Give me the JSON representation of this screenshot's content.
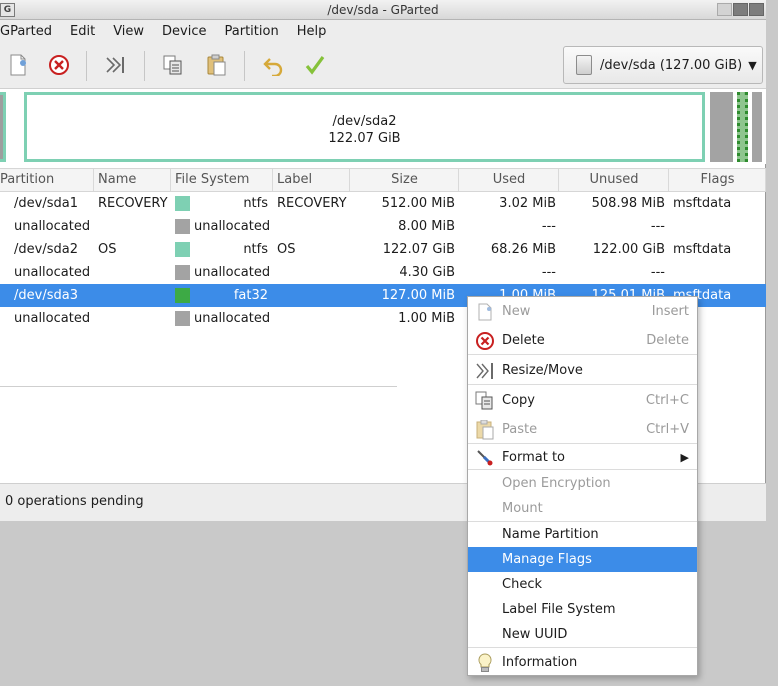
{
  "window": {
    "title": "/dev/sda - GParted",
    "app_icon_glyph": "G"
  },
  "menubar": {
    "items": [
      "GParted",
      "Edit",
      "View",
      "Device",
      "Partition",
      "Help"
    ]
  },
  "toolbar": {
    "buttons": [
      "new-icon",
      "delete-icon",
      "resize-move-icon",
      "copy-icon",
      "paste-icon",
      "undo-icon",
      "apply-icon"
    ],
    "device": "/dev/sda (127.00 GiB)"
  },
  "map": {
    "selected_partition": {
      "name": "/dev/sda2",
      "size": "122.07 GiB"
    }
  },
  "table": {
    "headers": [
      "Partition",
      "Name",
      "File System",
      "Label",
      "Size",
      "Used",
      "Unused",
      "Flags"
    ],
    "rows": [
      {
        "partition": "/dev/sda1",
        "name": "RECOVERY",
        "fs": "ntfs",
        "fs_color": "#7ed0b3",
        "label": "RECOVERY",
        "size": "512.00 MiB",
        "used": "3.02 MiB",
        "unused": "508.98 MiB",
        "flags": "msftdata"
      },
      {
        "partition": "unallocated",
        "name": "",
        "fs": "unallocated",
        "fs_color": "#a3a3a3",
        "label": "",
        "size": "8.00 MiB",
        "used": "---",
        "unused": "---",
        "flags": ""
      },
      {
        "partition": "/dev/sda2",
        "name": "OS",
        "fs": "ntfs",
        "fs_color": "#7ed0b3",
        "label": "OS",
        "size": "122.07 GiB",
        "used": "68.26 MiB",
        "unused": "122.00 GiB",
        "flags": "msftdata"
      },
      {
        "partition": "unallocated",
        "name": "",
        "fs": "unallocated",
        "fs_color": "#a3a3a3",
        "label": "",
        "size": "4.30 GiB",
        "used": "---",
        "unused": "---",
        "flags": ""
      },
      {
        "partition": "/dev/sda3",
        "name": "",
        "fs": "fat32",
        "fs_color": "#3daa45",
        "label": "",
        "size": "127.00 MiB",
        "used": "1.00 MiB",
        "unused": "125.01 MiB",
        "flags": "msftdata"
      },
      {
        "partition": "unallocated",
        "name": "",
        "fs": "unallocated",
        "fs_color": "#a3a3a3",
        "label": "",
        "size": "1.00 MiB",
        "used": "",
        "unused": "",
        "flags": ""
      }
    ]
  },
  "status": {
    "text": "0 operations pending"
  },
  "context_menu": {
    "new": {
      "label": "New",
      "accel": "Insert"
    },
    "delete": {
      "label": "Delete",
      "accel": "Delete"
    },
    "resize": {
      "label": "Resize/Move"
    },
    "copy": {
      "label": "Copy",
      "accel": "Ctrl+C"
    },
    "paste": {
      "label": "Paste",
      "accel": "Ctrl+V"
    },
    "format": {
      "label": "Format to"
    },
    "open_encryption": {
      "label": "Open Encryption"
    },
    "mount": {
      "label": "Mount"
    },
    "name_partition": {
      "label": "Name Partition"
    },
    "manage_flags": {
      "label": "Manage Flags"
    },
    "check": {
      "label": "Check"
    },
    "label_fs": {
      "label": "Label File System"
    },
    "new_uuid": {
      "label": "New UUID"
    },
    "information": {
      "label": "Information"
    }
  },
  "colors": {
    "selection": "#3c8ce8",
    "ntfs": "#7ed0b3",
    "fat32": "#3daa45",
    "unallocated": "#a3a3a3"
  }
}
